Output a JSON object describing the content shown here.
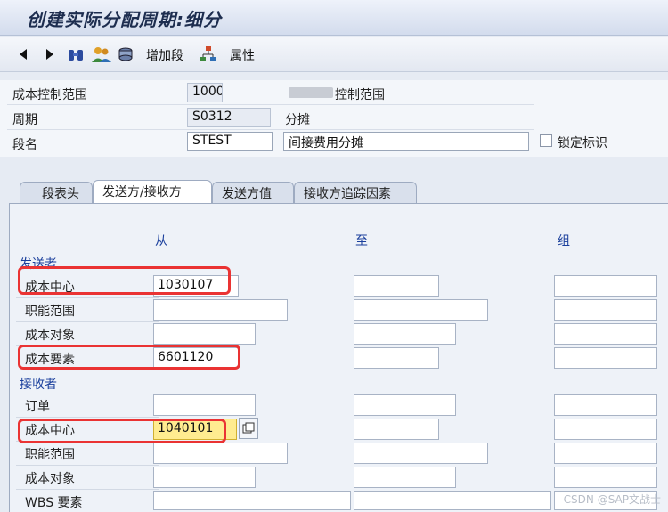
{
  "window": {
    "title": "创建实际分配周期:细分"
  },
  "toolbar": {
    "icons": [
      "arrow-left-icon",
      "arrow-right-icon",
      "binoculars-icon",
      "people-icon",
      "server-icon",
      "hierarchy-icon"
    ],
    "add_segment_label": "增加段",
    "attributes_label": "属性"
  },
  "header": {
    "controlling_area_label": "成本控制范围",
    "controlling_area_value": "1000",
    "controlling_area_desc": "控制范围",
    "period_label": "周期",
    "period_value": "S0312",
    "period_desc": "分摊",
    "segment_label": "段名",
    "segment_value": "STEST",
    "segment_desc": "间接费用分摊",
    "lock_label": "锁定标识",
    "lock_checked": false
  },
  "tabs": [
    {
      "label": "段表头",
      "active": false
    },
    {
      "label": "发送方/接收方",
      "active": true
    },
    {
      "label": "发送方值",
      "active": false
    },
    {
      "label": "接收方追踪因素",
      "active": false
    }
  ],
  "columns": {
    "from": "从",
    "to": "至",
    "group": "组"
  },
  "sender": {
    "title": "发送者",
    "rows": [
      {
        "label": "成本中心",
        "from": "1030107",
        "to": "",
        "group": ""
      },
      {
        "label": "职能范围",
        "from": "",
        "to": "",
        "group": ""
      },
      {
        "label": "成本对象",
        "from": "",
        "to": "",
        "group": ""
      },
      {
        "label": "成本要素",
        "from": "6601120",
        "to": "",
        "group": ""
      }
    ]
  },
  "receiver": {
    "title": "接收者",
    "rows": [
      {
        "label": "订单",
        "from": "",
        "to": "",
        "group": ""
      },
      {
        "label": "成本中心",
        "from": "1040101",
        "to": "",
        "group": ""
      },
      {
        "label": "职能范围",
        "from": "",
        "to": "",
        "group": ""
      },
      {
        "label": "成本对象",
        "from": "",
        "to": "",
        "group": ""
      },
      {
        "label": "WBS 要素",
        "from": "",
        "to": "",
        "group": ""
      }
    ]
  },
  "watermark": "CSDN @SAP文战士",
  "colors": {
    "accent": "#1a3f9c",
    "highlight": "#ea3333",
    "focus": "#ffec90"
  }
}
